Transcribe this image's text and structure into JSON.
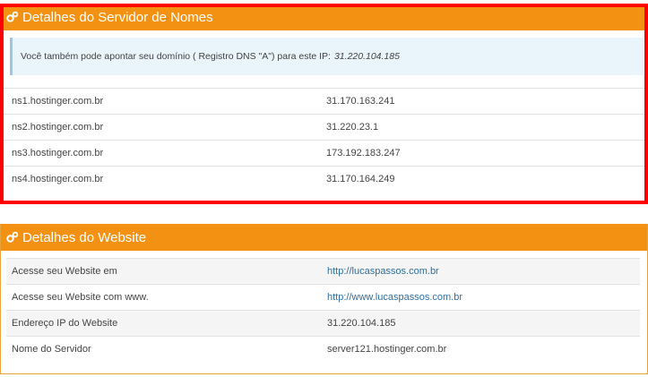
{
  "nameserver_panel": {
    "title": "Detalhes do Servidor de Nomes",
    "notice_text": "Você também pode apontar seu domínio ( Registro DNS \"A\") para este IP:",
    "notice_ip": "31.220.104.185",
    "rows": [
      {
        "name": "ns1.hostinger.com.br",
        "ip": "31.170.163.241"
      },
      {
        "name": "ns2.hostinger.com.br",
        "ip": "31.220.23.1"
      },
      {
        "name": "ns3.hostinger.com.br",
        "ip": "173.192.183.247"
      },
      {
        "name": "ns4.hostinger.com.br",
        "ip": "31.170.164.249"
      }
    ]
  },
  "website_panel": {
    "title": "Detalhes do Website",
    "rows": [
      {
        "label": "Acesse seu Website em",
        "value": "http://lucaspassos.com.br"
      },
      {
        "label": "Acesse seu Website com www.",
        "value": "http://www.lucaspassos.com.br"
      },
      {
        "label": "Endereço IP do Website",
        "value": "31.220.104.185"
      },
      {
        "label": "Nome do Servidor",
        "value": "server121.hostinger.com.br"
      }
    ]
  },
  "colors": {
    "header_orange": "#f39212",
    "highlight_red": "#ff0000",
    "link_blue": "#2f6f9f",
    "notice_bg": "#e9f4fb"
  },
  "icons": {
    "header_icon": "gears-icon"
  }
}
